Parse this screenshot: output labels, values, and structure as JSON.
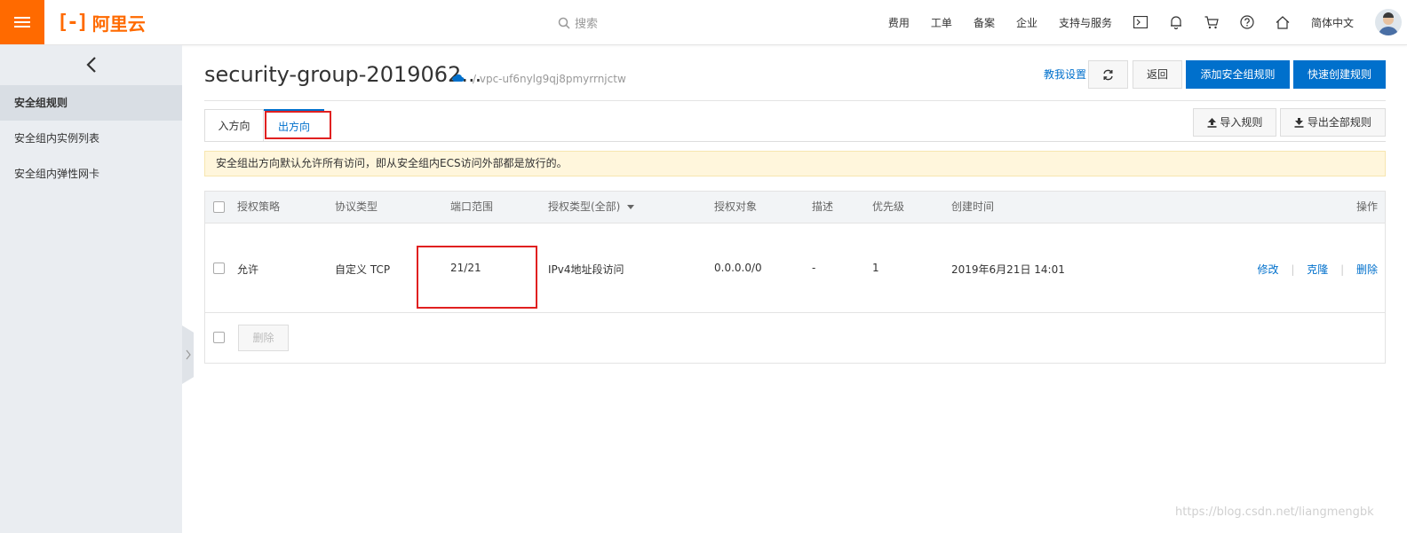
{
  "topbar": {
    "logo_text": "阿里云",
    "search_placeholder": "搜索",
    "nav": [
      "费用",
      "工单",
      "备案",
      "企业",
      "支持与服务"
    ],
    "icons": [
      "terminal-icon",
      "bell-icon",
      "cart-icon",
      "help-icon",
      "home-icon"
    ],
    "language": "简体中文"
  },
  "sidebar": {
    "items": [
      {
        "label": "安全组规则",
        "active": true
      },
      {
        "label": "安全组内实例列表",
        "active": false
      },
      {
        "label": "安全组内弹性网卡",
        "active": false
      }
    ]
  },
  "header": {
    "title": "security-group-2019062...",
    "vpc": "/ vpc-uf6nylg9qj8pmyrrnjctw",
    "help_link": "教我设置",
    "back": "返回",
    "add_rule": "添加安全组规则",
    "quick_create": "快速创建规则"
  },
  "tabs": {
    "inbound": "入方向",
    "outbound": "出方向",
    "import": "导入规则",
    "export": "导出全部规则"
  },
  "notice": "安全组出方向默认允许所有访问，即从安全组内ECS访问外部都是放行的。",
  "table": {
    "columns": [
      "授权策略",
      "协议类型",
      "端口范围",
      "授权类型(全部)",
      "授权对象",
      "描述",
      "优先级",
      "创建时间",
      "操作"
    ],
    "rows": [
      {
        "policy": "允许",
        "protocol": "自定义 TCP",
        "port": "21/21",
        "auth_type": "IPv4地址段访问",
        "target": "0.0.0.0/0",
        "desc": "-",
        "priority": "1",
        "created": "2019年6月21日 14:01",
        "actions": {
          "edit": "修改",
          "clone": "克隆",
          "delete": "删除"
        }
      }
    ],
    "footer_delete": "删除"
  },
  "watermark": "https://blog.csdn.net/liangmengbk",
  "colors": {
    "brand": "#ff6a00",
    "primary": "#0070cc",
    "highlight": "#e02020"
  }
}
